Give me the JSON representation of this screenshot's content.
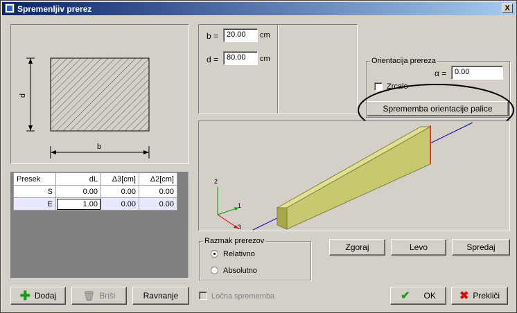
{
  "window": {
    "title": "Spremenljiv prerez",
    "close_label": "X"
  },
  "section_preview": {
    "dim_d": "d",
    "dim_b": "b"
  },
  "dimensions": {
    "b_label": "b =",
    "b_value": "20.00",
    "b_unit": "cm",
    "d_label": "d =",
    "d_value": "80.00",
    "d_unit": "cm"
  },
  "orientation": {
    "group_title": "Orientacija prereza",
    "alpha_label": "α =",
    "alpha_value": "0.00",
    "mirror_label": "Zrcalo",
    "change_button": "Sprememba orientacije palice"
  },
  "table": {
    "headers": [
      "Presek",
      "dL",
      "Δ3[cm]",
      "Δ2[cm]"
    ],
    "rows": [
      {
        "name": "S",
        "dL": "0.00",
        "d3": "0.00",
        "d2": "0.00"
      },
      {
        "name": "E",
        "dL": "1.00",
        "d3": "0.00",
        "d2": "0.00"
      }
    ]
  },
  "axes": {
    "z": "2",
    "y": "1",
    "x": "3"
  },
  "spacing": {
    "group_title": "Razmak prerezov",
    "options": [
      "Relativno",
      "Absolutno"
    ],
    "selected": "Relativno"
  },
  "view_buttons": {
    "top": "Zgoraj",
    "left": "Levo",
    "front": "Spredaj"
  },
  "bottom": {
    "add": "Dodaj",
    "delete": "Briši",
    "align": "Ravnanje",
    "arc_label": "Ločna sprememba",
    "ok": "OK",
    "cancel": "Prekliči"
  },
  "colors": {
    "beam_top": "#c8c870",
    "beam_side": "#a0a040",
    "highlight": "#000000"
  }
}
